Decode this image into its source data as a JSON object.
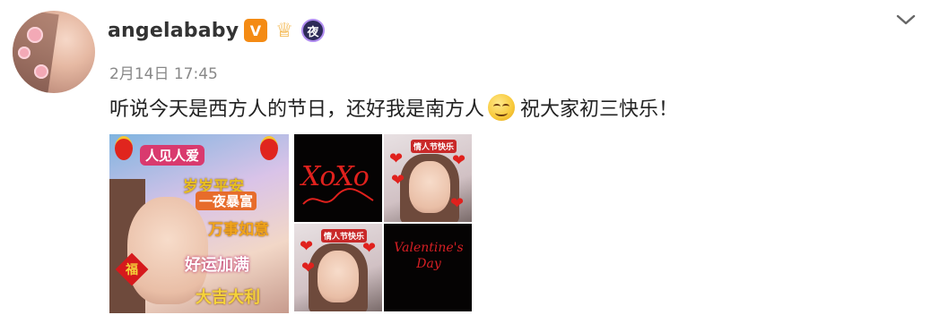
{
  "post": {
    "username": "angelababy",
    "timestamp": "2月14日 17:45",
    "text_before_emoji": "听说今天是西方人的节日，还好我是南方人",
    "text_after_emoji": "祝大家初三快乐！",
    "emoji": "smiling-face-emoji"
  },
  "badges": {
    "verified": "V",
    "night": "夜"
  },
  "images": {
    "main_overlay_texts": [
      "人见人爱",
      "岁岁平安",
      "一夜暴富",
      "万事如意",
      "好运加满",
      "大吉大利"
    ],
    "fu_char": "福",
    "xoxo_text": "XoXo",
    "selfie_tag": "情人节快乐",
    "valentine_text": "Valentine's Day"
  },
  "icons": {
    "menu": "chevron-down-icon"
  }
}
